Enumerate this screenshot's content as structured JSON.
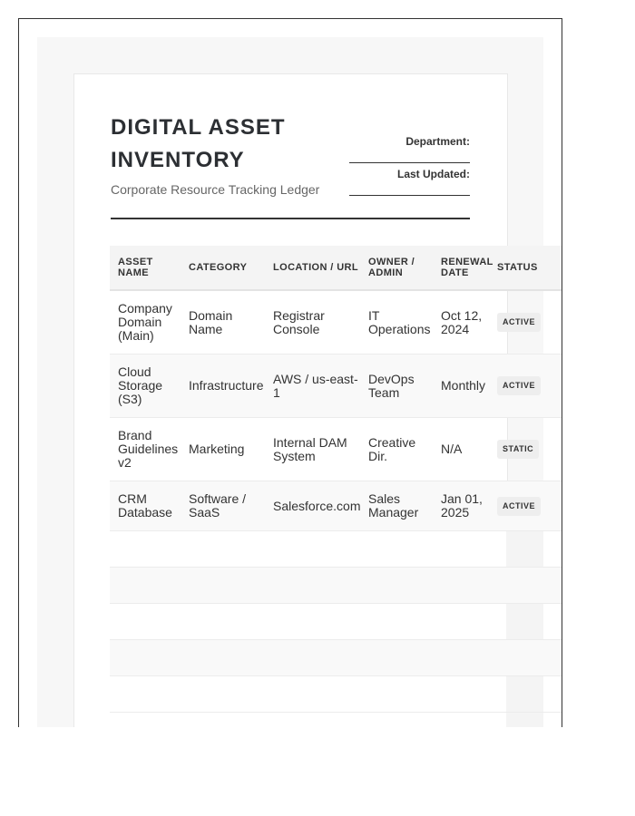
{
  "document": {
    "title": "DIGITAL ASSET INVENTORY",
    "subtitle": "Corporate Resource Tracking Ledger",
    "meta": [
      {
        "label": "Department:",
        "value": ""
      },
      {
        "label": "Last Updated:",
        "value": ""
      }
    ]
  },
  "table": {
    "columns": [
      "ASSET NAME",
      "CATEGORY",
      "LOCATION / URL",
      "OWNER / ADMIN",
      "RENEWAL DATE",
      "STATUS"
    ],
    "rows": [
      {
        "asset": "Company Domain (Main)",
        "category": "Domain Name",
        "location": "Registrar Console",
        "owner": "IT Operations",
        "renewal": "Oct 12, 2024",
        "status": "ACTIVE"
      },
      {
        "asset": "Cloud Storage (S3)",
        "category": "Infrastructure",
        "location": "AWS / us-east-1",
        "owner": "DevOps Team",
        "renewal": "Monthly",
        "status": "ACTIVE"
      },
      {
        "asset": "Brand Guidelines v2",
        "category": "Marketing",
        "location": "Internal DAM System",
        "owner": "Creative Dir.",
        "renewal": "N/A",
        "status": "STATIC"
      },
      {
        "asset": "CRM Database",
        "category": "Software / SaaS",
        "location": "Salesforce.com",
        "owner": "Sales Manager",
        "renewal": "Jan 01, 2025",
        "status": "ACTIVE"
      }
    ]
  }
}
